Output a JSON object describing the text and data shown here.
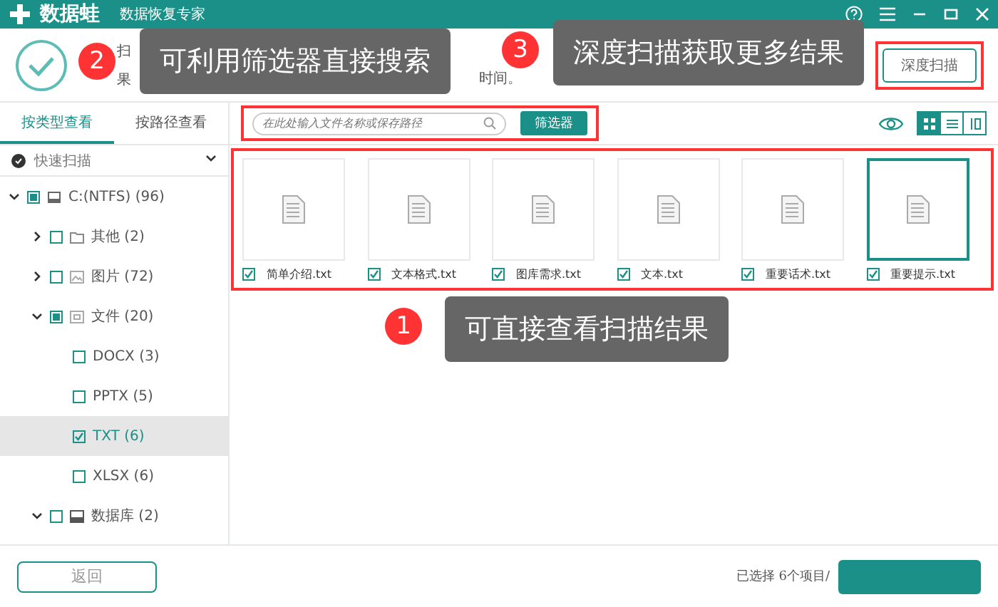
{
  "title_bar": {
    "brand": "数据蛙",
    "subtitle": "数据恢复专家"
  },
  "header": {
    "line1": "扫",
    "line2": "果",
    "line2_end": "时间。",
    "deep_scan_button": "深度扫描"
  },
  "sidebar": {
    "tabs": [
      {
        "label": "按类型查看",
        "selected": true
      },
      {
        "label": "按路径查看",
        "selected": false
      }
    ],
    "scan_mode": "快速扫描",
    "tree": [
      {
        "label": "C:(NTFS) (96)",
        "kind": "drive",
        "partial": true,
        "expanded": true,
        "selected": false,
        "children": [
          {
            "label": "其他 (2)",
            "kind": "folder",
            "checked": false,
            "expanded": false,
            "selected": false
          },
          {
            "label": "图片 (72)",
            "kind": "image",
            "checked": false,
            "expanded": false,
            "selected": false
          },
          {
            "label": "文件 (20)",
            "kind": "document",
            "partial": true,
            "expanded": true,
            "selected": false,
            "children": [
              {
                "label": "DOCX (3)",
                "checked": false,
                "selected": false
              },
              {
                "label": "PPTX (5)",
                "checked": false,
                "selected": false
              },
              {
                "label": "TXT (6)",
                "checked": true,
                "selected": true
              },
              {
                "label": "XLSX (6)",
                "checked": false,
                "selected": false
              }
            ]
          },
          {
            "label": "数据库 (2)",
            "kind": "database",
            "checked": false,
            "expanded": true,
            "selected": false
          }
        ]
      }
    ],
    "back_button": "返回"
  },
  "toolbar": {
    "search": {
      "placeholder": "在此处输入文件名称或保存路径"
    },
    "filter_button": "筛选器",
    "views": [
      {
        "kind": "grid",
        "selected": true
      },
      {
        "kind": "list",
        "selected": false
      },
      {
        "kind": "columns",
        "selected": false
      }
    ]
  },
  "files": [
    {
      "name": "简单介绍.txt",
      "checked": true,
      "selected": false
    },
    {
      "name": "文本格式.txt",
      "checked": true,
      "selected": false
    },
    {
      "name": "图库需求.txt",
      "checked": true,
      "selected": false
    },
    {
      "name": "文本.txt",
      "checked": true,
      "selected": false
    },
    {
      "name": "重要话术.txt",
      "checked": true,
      "selected": false
    },
    {
      "name": "重要提示.txt",
      "checked": true,
      "selected": true
    }
  ],
  "status": {
    "selection": "已选择 6个项目/"
  },
  "callouts": [
    {
      "number": "2",
      "text": "可利用筛选器直接搜索"
    },
    {
      "number": "3",
      "text": "深度扫描获取更多结果"
    },
    {
      "number": "1",
      "text": "可直接查看扫描结果"
    }
  ]
}
